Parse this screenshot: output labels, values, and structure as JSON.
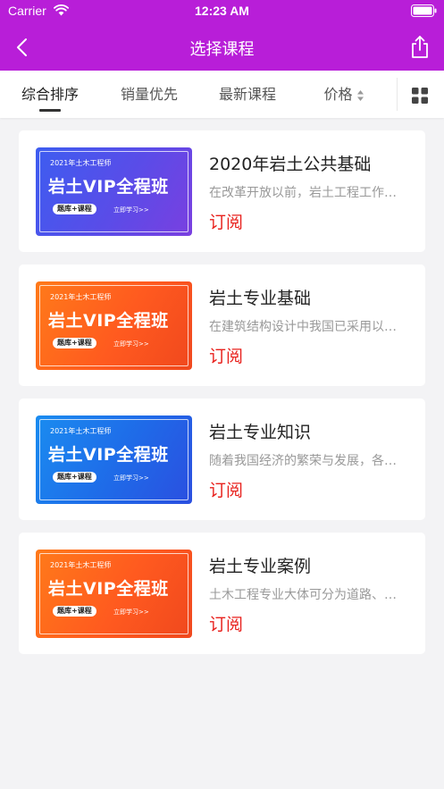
{
  "status_bar": {
    "carrier": "Carrier",
    "time": "12:23 AM"
  },
  "nav": {
    "title": "选择课程"
  },
  "sort_tabs": [
    {
      "label": "综合排序",
      "active": true
    },
    {
      "label": "销量优先",
      "active": false
    },
    {
      "label": "最新课程",
      "active": false
    },
    {
      "label": "价格",
      "active": false
    }
  ],
  "colors": {
    "header": "#b81ed8",
    "accent_red": "#e8201c"
  },
  "courses": [
    {
      "banner_year": "2021年土木工程师",
      "banner_title": "岩土VIP全程班",
      "banner_tag": "题库+课程",
      "banner_link": "立即学习>>",
      "banner_theme": "blue-purple",
      "title": "2020年岩土公共基础",
      "description": "在改革开放以前，岩土工程工作内容",
      "action": "订阅"
    },
    {
      "banner_year": "2021年土木工程师",
      "banner_title": "岩土VIP全程班",
      "banner_tag": "题库+课程",
      "banner_link": "立即学习>>",
      "banner_theme": "orange",
      "title": "岩土专业基础",
      "description": "在建筑结构设计中我国已采用以概率",
      "action": "订阅"
    },
    {
      "banner_year": "2021年土木工程师",
      "banner_title": "岩土VIP全程班",
      "banner_tag": "题库+课程",
      "banner_link": "立即学习>>",
      "banner_theme": "blue",
      "title": "岩土专业知识",
      "description": "随着我国经济的繁荣与发展，各种建",
      "action": "订阅"
    },
    {
      "banner_year": "2021年土木工程师",
      "banner_title": "岩土VIP全程班",
      "banner_tag": "题库+课程",
      "banner_link": "立即学习>>",
      "banner_theme": "orange",
      "title": "岩土专业案例",
      "description": "土木工程专业大体可分为道路、桥梁",
      "action": "订阅"
    }
  ]
}
